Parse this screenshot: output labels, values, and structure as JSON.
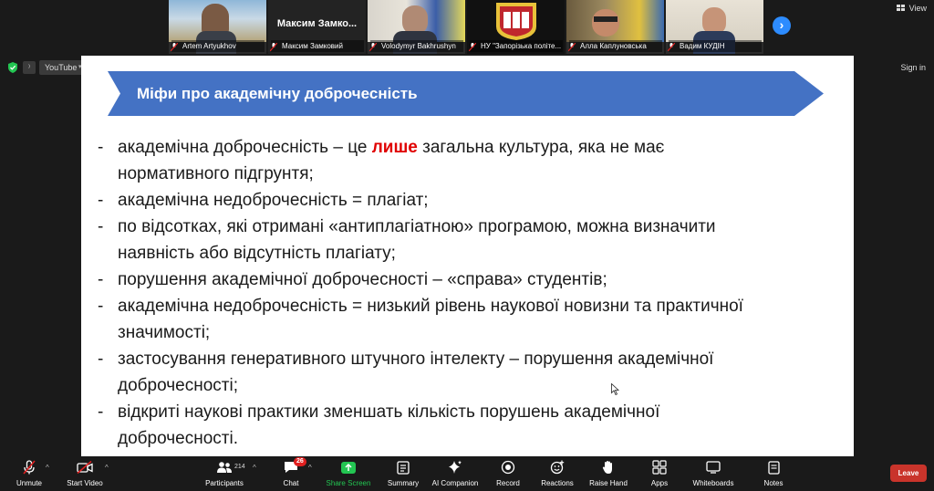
{
  "participants": [
    {
      "name": "Artem Artyukhov",
      "muted": true,
      "has_video": true
    },
    {
      "name": "Максим Замковий",
      "display": "Максим Замко...",
      "muted": true,
      "has_video": false
    },
    {
      "name": "Volodymyr Bakhrushyn",
      "muted": true,
      "has_video": true
    },
    {
      "name": "НУ \"Запорізька політе...",
      "muted": true,
      "has_video": true
    },
    {
      "name": "Алла Каплуновська",
      "muted": true,
      "has_video": true
    },
    {
      "name": "Вадим КУДІН",
      "muted": true,
      "has_video": true
    }
  ],
  "top_right": {
    "view_label": "View",
    "signin_label": "Sign in"
  },
  "share_bar": {
    "youtube_label": "YouTube"
  },
  "slide": {
    "title": "Міфи про академічну доброчесність",
    "banner_color": "#4472c4",
    "bullets": [
      {
        "pre": "академічна доброчесність – це ",
        "highlight": "лише",
        "post": " загальна культура, яка не має",
        "line2": "нормативного підгрунтя;"
      },
      {
        "pre": "академічна недоброчесність = плагіат;",
        "highlight": "",
        "post": "",
        "line2": ""
      },
      {
        "pre": "по відсотках, які отримані «антиплагіатною» програмою, можна визначити",
        "highlight": "",
        "post": "",
        "line2": "наявність або відсутність плагіату;"
      },
      {
        "pre": "порушення академічної доброчесності – «справа» студентів;",
        "highlight": "",
        "post": "",
        "line2": ""
      },
      {
        "pre": "академічна недоброчесність = низький рівень наукової новизни та практичної",
        "highlight": "",
        "post": "",
        "line2": "значимості;"
      },
      {
        "pre": "застосування генеративного штучного інтелекту – порушення академічної",
        "highlight": "",
        "post": "",
        "line2": "доброчесності;"
      },
      {
        "pre": "відкриті наукові практики зменшать кількість порушень академічної",
        "highlight": "",
        "post": "",
        "line2": "доброчесності."
      }
    ]
  },
  "toolbar": {
    "unmute": "Unmute",
    "start_video": "Start Video",
    "participants": "Participants",
    "participants_count": "214",
    "chat": "Chat",
    "chat_badge": "26",
    "share_screen": "Share Screen",
    "summary": "Summary",
    "ai_companion": "AI Companion",
    "record": "Record",
    "reactions": "Reactions",
    "raise_hand": "Raise Hand",
    "apps": "Apps",
    "whiteboards": "Whiteboards",
    "notes": "Notes",
    "leave": "Leave"
  },
  "colors": {
    "share_green": "#23c552",
    "leave_red": "#c9342b",
    "accent_blue": "#2d8cff"
  }
}
